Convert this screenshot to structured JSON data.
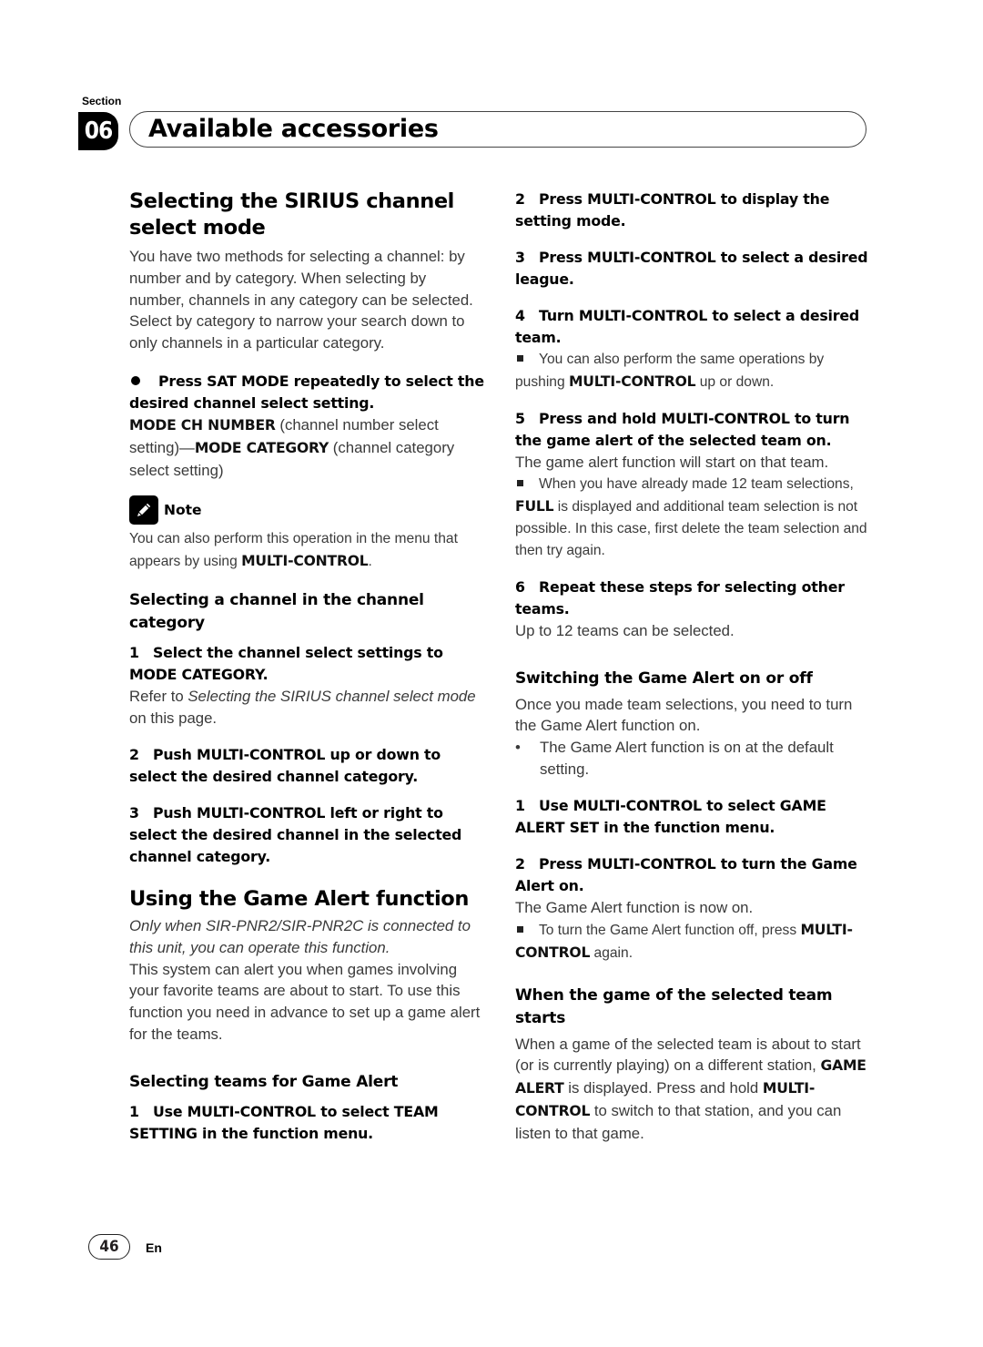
{
  "header": {
    "section_label": "Section",
    "section_number": "06",
    "title": "Available accessories"
  },
  "left": {
    "h_sirius": "Selecting the SIRIUS channel select mode",
    "p_sirius": "You have two methods for selecting a channel: by number and by category. When selecting by number, channels in any category can be selected. Select by category to narrow your search down to only channels in a particular category.",
    "press_step": "Press SAT MODE repeatedly to select the desired channel select setting.",
    "mode1_bold": "MODE CH NUMBER",
    "mode1_text": " (channel number select setting)—",
    "mode2_bold": "MODE CATEGORY",
    "mode2_text": " (channel category select setting)",
    "note_label": "Note",
    "note_text": "You can also perform this operation in the menu that appears by using ",
    "note_bold": "MULTI-CONTROL",
    "note_end": ".",
    "h_category": "Selecting a channel in the channel category",
    "cat_steps": [
      {
        "num": "1",
        "text": "Select the channel select settings to MODE CATEGORY."
      },
      {
        "num": "2",
        "text": "Push MULTI-CONTROL up or down to select the desired channel category."
      },
      {
        "num": "3",
        "text": "Push MULTI-CONTROL left or right to select the desired channel in the selected channel category."
      }
    ],
    "refer_pre": "Refer to ",
    "refer_italic": "Selecting the SIRIUS channel select mode",
    "refer_post": " on this page.",
    "h_game": "Using the Game Alert function",
    "game_italic": "Only when SIR-PNR2/SIR-PNR2C is connected to this unit, you can operate this function.",
    "game_body": "This system can alert you when games involving your favorite teams are about to start. To use this function you need in advance to set up a game alert for the teams.",
    "h_teams": "Selecting teams for Game Alert",
    "team_step1": {
      "num": "1",
      "text": "Use MULTI-CONTROL to select TEAM SETTING in the function menu."
    }
  },
  "right": {
    "steps": [
      {
        "num": "2",
        "text": "Press MULTI-CONTROL to display the setting mode."
      },
      {
        "num": "3",
        "text": "Press MULTI-CONTROL to select a desired league."
      },
      {
        "num": "4",
        "text": "Turn MULTI-CONTROL to select a desired team."
      }
    ],
    "step4_note_pre": "You can also perform the same operations by pushing ",
    "step4_note_bold": "MULTI-CONTROL",
    "step4_note_post": " up or down.",
    "step5": {
      "num": "5",
      "text": "Press and hold MULTI-CONTROL to turn the game alert of the selected team on."
    },
    "step5_body": "The game alert function will start on that team.",
    "step5_note_pre": "When you have already made 12 team selections, ",
    "step5_note_bold": "FULL",
    "step5_note_post": " is displayed and additional team selection is not possible. In this case, first delete the team selection and then try again.",
    "step6": {
      "num": "6",
      "text": "Repeat these steps for selecting other teams."
    },
    "step6_body": "Up to 12 teams can be selected.",
    "h_switch": "Switching the Game Alert on or off",
    "switch_body": "Once you made team selections, you need to turn the Game Alert function on.",
    "switch_bullet": "The Game Alert function is on at the default setting.",
    "switch_step1": {
      "num": "1",
      "text": "Use MULTI-CONTROL to select GAME ALERT SET in the function menu."
    },
    "switch_step2": {
      "num": "2",
      "text": "Press MULTI-CONTROL to turn the Game Alert on."
    },
    "switch_step2_body": "The Game Alert function is now on.",
    "switch_note_pre": "To turn the Game Alert function off, press ",
    "switch_note_bold": "MULTI-CONTROL",
    "switch_note_post": " again.",
    "h_when": "When the game of the selected team starts",
    "when_pre": "When a game of the selected team is about to start (or is currently playing) on a different station, ",
    "when_bold1": "GAME ALERT",
    "when_mid": " is displayed. Press and hold ",
    "when_bold2": "MULTI-CONTROL",
    "when_post": " to switch to that station, and you can listen to that game."
  },
  "footer": {
    "page_number": "46",
    "language": "En"
  }
}
